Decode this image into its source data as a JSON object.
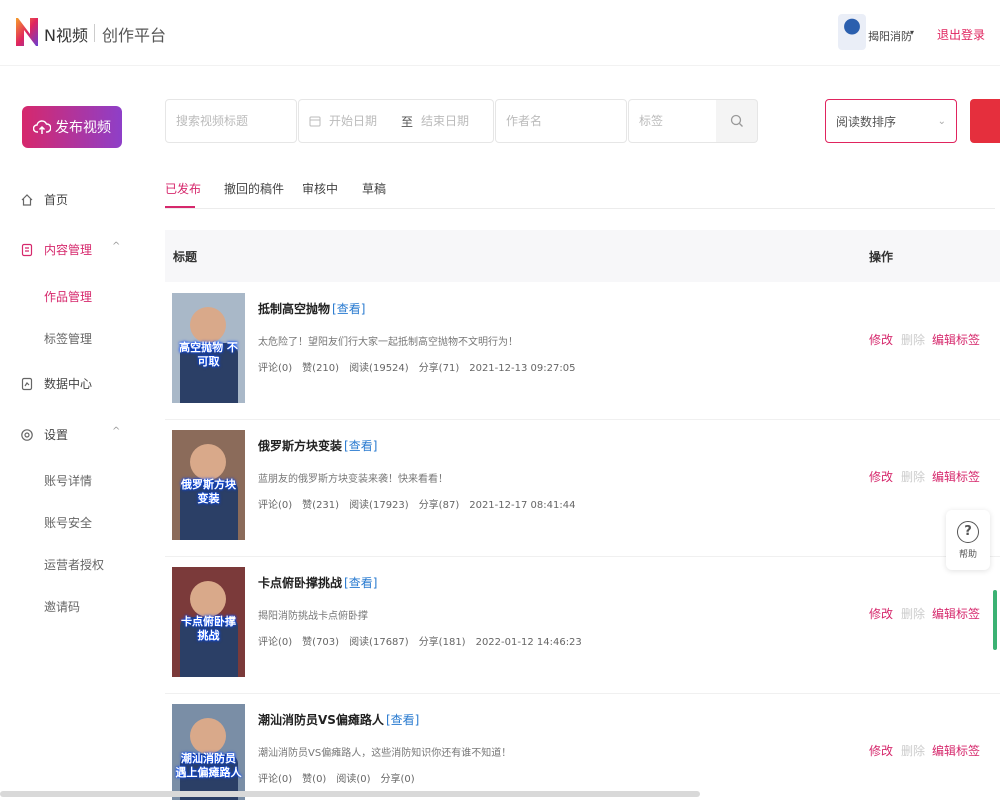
{
  "header": {
    "brand": "N视频",
    "platform": "创作平台",
    "user_name": "揭阳消防",
    "user_caret": "▾",
    "logout": "退出登录"
  },
  "sidebar": {
    "publish_label": "发布视频",
    "items": [
      {
        "label": "首页",
        "icon": "home-icon"
      },
      {
        "label": "内容管理",
        "icon": "content-icon",
        "caret": "^",
        "active": true
      },
      {
        "label": "数据中心",
        "icon": "data-icon"
      },
      {
        "label": "设置",
        "icon": "settings-icon",
        "caret": "^"
      }
    ],
    "content_sub": [
      "作品管理",
      "标签管理"
    ],
    "settings_sub": [
      "账号详情",
      "账号安全",
      "运营者授权",
      "邀请码"
    ]
  },
  "filters": {
    "title_placeholder": "搜索视频标题",
    "start_placeholder": "开始日期",
    "range_sep": "至",
    "end_placeholder": "结束日期",
    "author_placeholder": "作者名",
    "tag_placeholder": "标签",
    "sort_value": "阅读数排序"
  },
  "tabs": [
    "已发布",
    "撤回的稿件",
    "审核中",
    "草稿"
  ],
  "table": {
    "col_title": "标题",
    "col_ops": "操作",
    "view_label": "[查看]",
    "op_edit": "修改",
    "op_delete": "删除",
    "op_tags": "编辑标签",
    "rows": [
      {
        "title": "抵制高空抛物",
        "desc": "太危险了！望阳友们行大家一起抵制高空抛物不文明行为！",
        "comments": "评论(0)",
        "likes": "赞(210)",
        "reads": "阅读(19524)",
        "shares": "分享(71)",
        "time": "2021-12-13 09:27:05",
        "caption": "高空抛物 不可取",
        "bg": "#a9b8c8"
      },
      {
        "title": "俄罗斯方块变装",
        "desc": "蓝朋友的俄罗斯方块变装来袭！快来看看！",
        "comments": "评论(0)",
        "likes": "赞(231)",
        "reads": "阅读(17923)",
        "shares": "分享(87)",
        "time": "2021-12-17 08:41:44",
        "caption": "俄罗斯方块 变装",
        "bg": "#8b6b5a"
      },
      {
        "title": "卡点俯卧撑挑战",
        "desc": "揭阳消防挑战卡点俯卧撑",
        "comments": "评论(0)",
        "likes": "赞(703)",
        "reads": "阅读(17687)",
        "shares": "分享(181)",
        "time": "2022-01-12 14:46:23",
        "caption": "卡点俯卧撑 挑战",
        "bg": "#7b3a3a"
      },
      {
        "title": "潮汕消防员VS偏瘫路人",
        "desc": "潮汕消防员VS偏瘫路人，这些消防知识你还有谁不知道！",
        "comments": "评论(0)",
        "likes": "赞(0)",
        "reads": "阅读(0)",
        "shares": "分享(0)",
        "time": "",
        "caption": "潮汕消防员 遇上偏瘫路人",
        "bg": "#7a8ea6"
      }
    ]
  },
  "help_label": "帮助"
}
